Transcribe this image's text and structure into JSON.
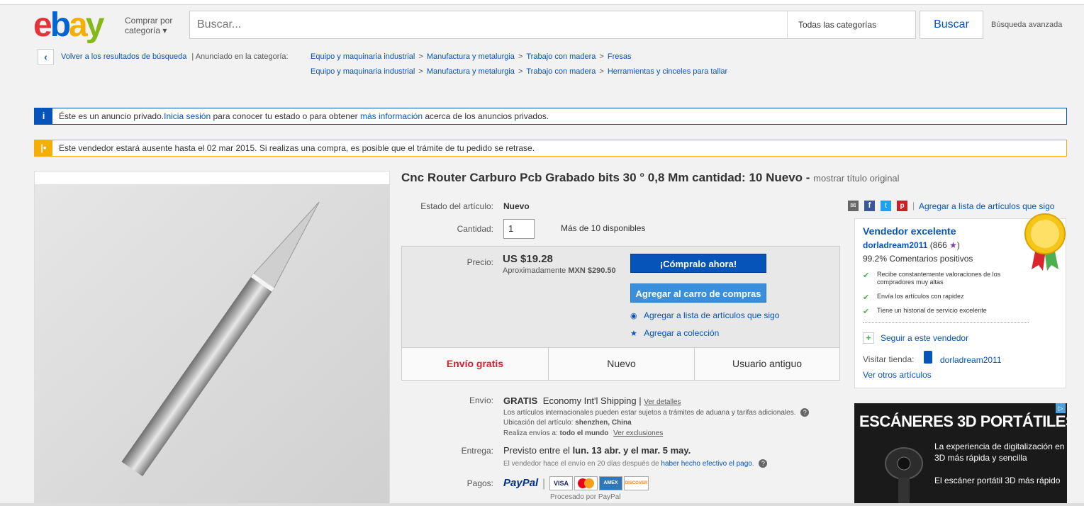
{
  "header": {
    "logo": {
      "e": "e",
      "b": "b",
      "a": "a",
      "y": "y"
    },
    "shop_by": [
      "Comprar por",
      "categoría"
    ],
    "search_placeholder": "Buscar...",
    "category": "Todas las categorías",
    "search_button": "Buscar",
    "advanced": "Búsqueda avanzada"
  },
  "breadcrumb": {
    "back": "Volver a los resultados de búsqueda",
    "listed_in": "| Anunciado en la categoría:",
    "path1": [
      "Equipo y maquinaria industrial",
      "Manufactura y metalurgia",
      "Trabajo con madera",
      "Fresas"
    ],
    "path2": [
      "Equipo y maquinaria industrial",
      "Manufactura y metalurgia",
      "Trabajo con madera",
      "Herramientas y cinceles para tallar"
    ],
    "separator": ">"
  },
  "banners": {
    "private": {
      "icon": "i",
      "pre": "Éste es un anuncio privado.",
      "link1": "Inicia sesión",
      "mid": " para conocer tu estado o para obtener ",
      "link2": "más información",
      "post": " acerca de los anuncios privados."
    },
    "away": {
      "icon": "|•",
      "text": "Este vendedor estará ausente hasta el 02 mar 2015. Si realizas una compra, es posible que el trámite de tu pedido se retrase."
    }
  },
  "item": {
    "title": "Cnc Router Carburo Pcb Grabado bits 30 ° 0,8 Mm cantidad: 10 Nuevo -",
    "show_original": "mostrar título original",
    "condition_label": "Estado del artículo:",
    "condition": "Nuevo",
    "quantity_label": "Cantidad:",
    "quantity": "1",
    "available": "Más de 10 disponibles",
    "price_label": "Precio:",
    "price": "US $19.28",
    "approx_prefix": "Aproximadamente",
    "approx_value": "MXN $290.50",
    "buy_now": "¡Cómpralo ahora!",
    "add_cart": "Agregar al carro de compras",
    "watch": "Agregar a lista de artículos que sigo",
    "collection": "Agregar a colección",
    "features": [
      "Envío gratis",
      "Nuevo",
      "Usuario antiguo"
    ],
    "accent_color": "#dd1e31"
  },
  "shipping": {
    "label": "Envío:",
    "free": "GRATIS",
    "service": "Economy Int'l Shipping |",
    "details_link": "Ver detalles",
    "customs": "Los artículos internacionales pueden estar sujetos a trámites de aduana y tarifas adicionales.",
    "location_label": "Ubicación del artículo:",
    "location": "shenzhen, China",
    "ships_to_label": "Realiza envíos a:",
    "ships_to": "todo el mundo",
    "exclusions": "Ver exclusiones"
  },
  "delivery": {
    "label": "Entrega:",
    "prefix": "Previsto entre el",
    "range": "lun. 13 abr. y el mar. 5 may.",
    "note_pre": "El vendedor hace el envío en 20 días después de",
    "note_link": "haber hecho efectivo el pago",
    "note_post": "."
  },
  "payments": {
    "label": "Pagos:",
    "paypal": "PayPal",
    "cards": [
      "VISA",
      "MC",
      "AMEX",
      "DISCOVER"
    ],
    "processed": "Procesado por PayPal"
  },
  "share": {
    "watch_link": "Agregar a lista de artículos que sigo",
    "icons": [
      "email-icon",
      "facebook-icon",
      "twitter-icon",
      "pinterest-icon"
    ]
  },
  "seller": {
    "top_rated": "Vendedor excelente",
    "name": "dorladream2011",
    "score": "(866",
    "score_close": ")",
    "positive": "99.2% Comentarios positivos",
    "points": [
      "Recibe constantemente valoraciones de los compradores muy altas",
      "Envía los artículos con rapidez",
      "Tiene un historial de servicio excelente"
    ],
    "follow": "Seguir a este vendedor",
    "visit_label": "Visitar tienda:",
    "store": "dorladream2011",
    "other_items": "Ver otros artículos"
  },
  "ad": {
    "headline": "ESCÁNERES 3D PORTÁTILES",
    "line1": "La experiencia de digitalización en 3D más rápida y sencilla",
    "line2": "El escáner portátil 3D más rápido"
  }
}
